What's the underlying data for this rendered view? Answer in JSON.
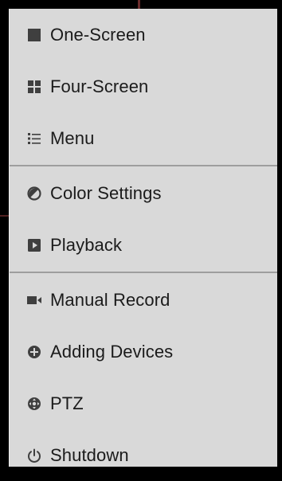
{
  "menu": {
    "sections": [
      {
        "items": [
          {
            "label": "One-Screen",
            "icon": "one-screen-icon"
          },
          {
            "label": "Four-Screen",
            "icon": "four-screen-icon"
          },
          {
            "label": "Menu",
            "icon": "list-menu-icon"
          }
        ]
      },
      {
        "items": [
          {
            "label": "Color Settings",
            "icon": "color-settings-icon"
          },
          {
            "label": "Playback",
            "icon": "playback-icon"
          }
        ]
      },
      {
        "items": [
          {
            "label": "Manual Record",
            "icon": "manual-record-icon"
          },
          {
            "label": "Adding Devices",
            "icon": "add-device-icon"
          },
          {
            "label": "PTZ",
            "icon": "ptz-icon"
          },
          {
            "label": "Shutdown",
            "icon": "power-icon"
          }
        ]
      }
    ]
  },
  "colors": {
    "panel_background": "#d9d9d9",
    "page_background": "#000000",
    "text": "#1b1b1b",
    "icon": "#3f3f3f",
    "divider": "#9e9e9e"
  }
}
